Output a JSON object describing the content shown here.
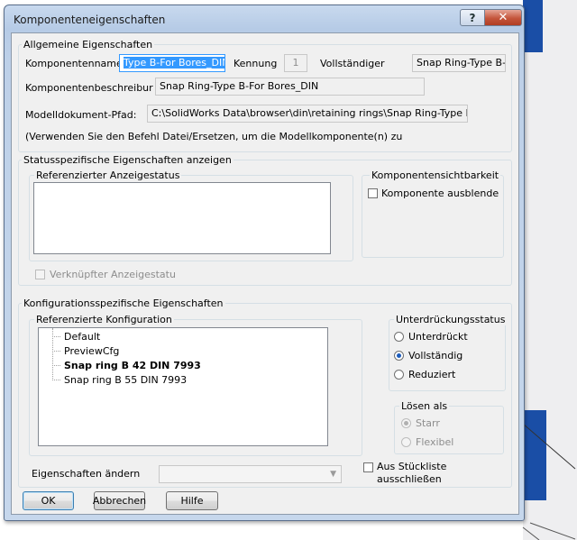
{
  "window": {
    "title": "Komponenteneigenschaften",
    "help_glyph": "?",
    "close_glyph": "✕"
  },
  "general": {
    "legend": "Allgemeine Eigenschaften",
    "component_name_label": "Komponentenname",
    "component_name_value": "Type B-For Bores_DIN",
    "id_label": "Kennung",
    "id_value": "1",
    "full_label": "Vollständiger",
    "full_value": "Snap Ring-Type B-",
    "description_label": "Komponentenbeschreibur",
    "description_value": "Snap Ring-Type B-For Bores_DIN",
    "path_label": "Modelldokument-Pfad:",
    "path_value": "C:\\SolidWorks Data\\browser\\din\\retaining rings\\Snap Ring-Type B-I",
    "hint": "(Verwenden Sie den Befehl Datei/Ersetzen, um die Modellkomponente(n) zu"
  },
  "display_state": {
    "legend": "Statusspezifische Eigenschaften anzeigen",
    "referenced_label": "Referenzierter Anzeigestatus",
    "visibility_legend": "Komponentensichtbarkeit",
    "hide_label": "Komponente ausblende",
    "linked_label": "Verknüpfter Anzeigestatu"
  },
  "config": {
    "legend": "Konfigurationsspezifische Eigenschaften",
    "referenced_label": "Referenzierte Konfiguration",
    "items": [
      "Default",
      "PreviewCfg",
      "Snap ring B 42 DIN 7993",
      "Snap ring B 55 DIN 7993"
    ],
    "suppression_legend": "Unterdrückungsstatus",
    "suppression_options": [
      "Unterdrückt",
      "Vollständig",
      "Reduziert"
    ],
    "solve_legend": "Lösen als",
    "solve_options": [
      "Starr",
      "Flexibel"
    ],
    "change_props_label": "Eigenschaften ändern",
    "bom_label_line1": "Aus Stückliste",
    "bom_label_line2": "ausschließen"
  },
  "buttons": {
    "ok": "OK",
    "cancel": "Abbrechen",
    "help": "Hilfe"
  }
}
